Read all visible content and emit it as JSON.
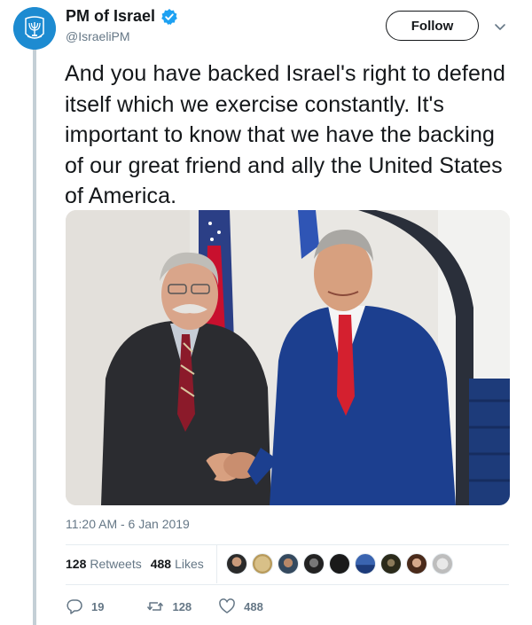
{
  "author": {
    "name": "PM of Israel",
    "handle": "@IsraeliPM",
    "verified": true,
    "avatar_icon": "israel-emblem-icon",
    "avatar_color": "#1d8bd1"
  },
  "follow_button": {
    "label": "Follow"
  },
  "tweet": {
    "text": "And you have backed Israel's right to defend itself which we exercise constantly. It's important to know that we have the backing of our great friend and ally the United States of America.",
    "timestamp": "11:20 AM - 6 Jan 2019"
  },
  "photo": {
    "icon": "photo-two-men-handshake"
  },
  "stats": {
    "retweets_count": "128",
    "retweets_label": "Retweets",
    "likes_count": "488",
    "likes_label": "Likes"
  },
  "actions": {
    "reply_count": "19",
    "retweet_count": "128",
    "like_count": "488"
  },
  "colors": {
    "verified_blue": "#1da1f2",
    "muted_text": "#657786",
    "divider": "#e6ecf0"
  }
}
